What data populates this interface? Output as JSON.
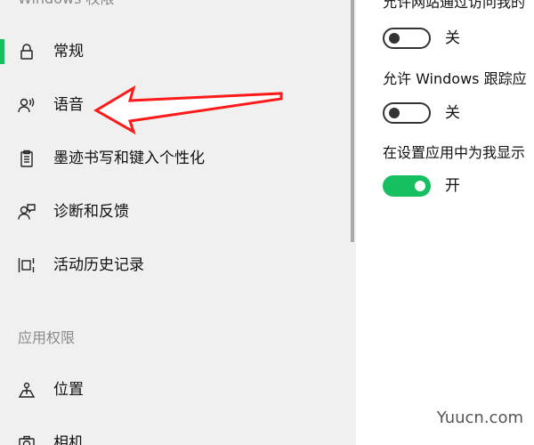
{
  "colors": {
    "accent": "#16c060",
    "sidebar_bg": "#f0f0f0",
    "arrow": "#ff1a1a"
  },
  "sidebar": {
    "section_windows": "Windows 权限",
    "section_app": "应用权限",
    "items": [
      {
        "label": "常规",
        "icon": "lock-icon",
        "selected": true
      },
      {
        "label": "语音",
        "icon": "speech-icon",
        "selected": false
      },
      {
        "label": "墨迹书写和键入个性化",
        "icon": "clipboard-icon",
        "selected": false
      },
      {
        "label": "诊断和反馈",
        "icon": "feedback-icon",
        "selected": false
      },
      {
        "label": "活动历史记录",
        "icon": "activity-history-icon",
        "selected": false
      },
      {
        "label": "位置",
        "icon": "location-icon",
        "selected": false
      },
      {
        "label": "相机",
        "icon": "camera-icon",
        "selected": false
      }
    ]
  },
  "settings": [
    {
      "description": "允许网站通过访问我的",
      "state_label": "关",
      "enabled": false
    },
    {
      "description": "允许 Windows 跟踪应",
      "state_label": "关",
      "enabled": false
    },
    {
      "description": "在设置应用中为我显示",
      "state_label": "开",
      "enabled": true
    }
  ],
  "watermark": "Yuucn.com"
}
